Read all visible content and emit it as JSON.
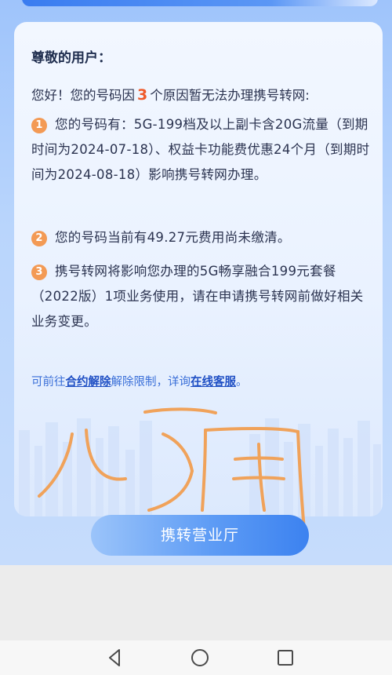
{
  "notice": {
    "title": "尊敬的用户：",
    "intro_before": "您好！您的号码因",
    "reason_count": "3",
    "intro_after": "个原因暂无法办理携号转网:",
    "reasons": [
      {
        "number": "1",
        "text": "您的号码有：5G-199档及以上副卡含20G流量（到期时间为2024-07-18）、权益卡功能费优惠24个月（到期时间为2024-08-18）影响携号转网办理。"
      },
      {
        "number": "2",
        "text": "您的号码当前有49.27元费用尚未缴清。"
      },
      {
        "number": "3",
        "text": "携号转网将影响您办理的5G畅享融合199元套餐（2022版）1项业务使用，请在申请携号转网前做好相关业务变更。"
      }
    ],
    "help": {
      "prefix": "可前往",
      "link_contract": "合约解除",
      "middle": "解除限制，详询",
      "link_service": "在线客服",
      "suffix": "。"
    }
  },
  "handwriting": {
    "text": "儿子用",
    "color": "#f0a25a"
  },
  "primary_button": {
    "label": "携转营业厅"
  },
  "nav": {
    "back_icon": "back-triangle-icon",
    "home_icon": "home-circle-icon",
    "recents_icon": "recents-square-icon"
  },
  "colors": {
    "accent_orange": "#ef5a2b",
    "badge_orange": "#f39a55",
    "link_blue": "#1f4fc4",
    "button_blue": "#3c82f0"
  }
}
